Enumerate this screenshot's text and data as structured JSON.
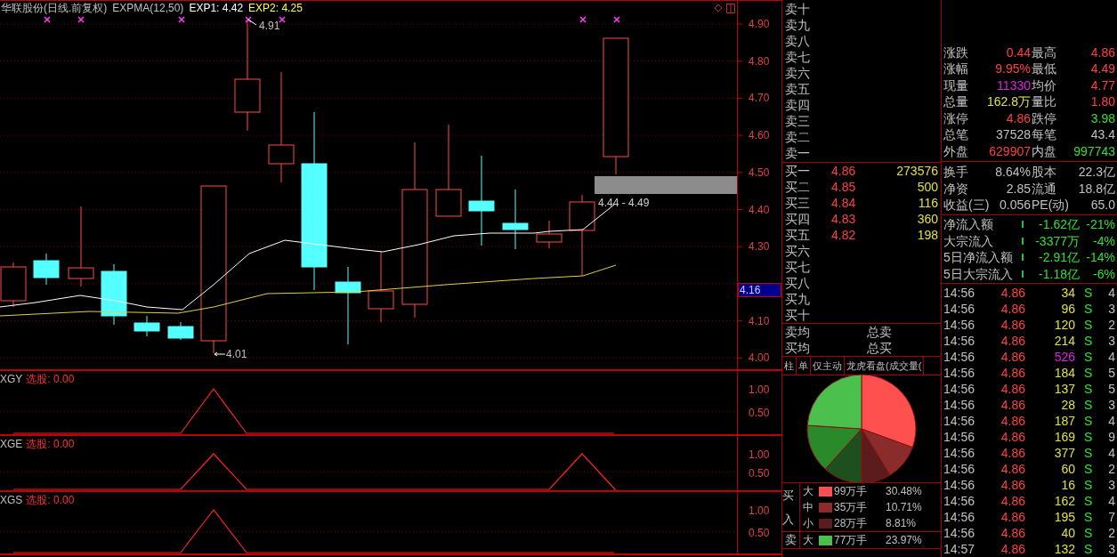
{
  "chart_header": {
    "title": "华联股份(日线.前复权)",
    "indicator": "EXPMA(12,50)",
    "exp1": "EXP1: 4.42",
    "exp2": "EXP2: 4.25"
  },
  "price_axis": {
    "ticks": [
      "4.90",
      "4.80",
      "4.70",
      "4.60",
      "4.50",
      "4.40",
      "4.30",
      "4.10",
      "4.00"
    ],
    "current_price": "4.16"
  },
  "chart_labels": {
    "high": "4.91",
    "low": "4.01",
    "range": "4.44 - 4.49"
  },
  "indicators": [
    {
      "name": "XGY",
      "label": "选股: 0.00",
      "ticks": [
        "1.00",
        "0.50"
      ]
    },
    {
      "name": "XGE",
      "label": "选股: 0.00",
      "ticks": [
        "1.00",
        "0.50"
      ]
    },
    {
      "name": "XGS",
      "label": "选股: 0.00",
      "ticks": [
        "1.00",
        "0.50"
      ]
    }
  ],
  "order_book": {
    "sell": [
      {
        "label": "卖十"
      },
      {
        "label": "卖九"
      },
      {
        "label": "卖八"
      },
      {
        "label": "卖七"
      },
      {
        "label": "卖六"
      },
      {
        "label": "卖五"
      },
      {
        "label": "卖四"
      },
      {
        "label": "卖三"
      },
      {
        "label": "卖二"
      },
      {
        "label": "卖一"
      }
    ],
    "buy": [
      {
        "label": "买一",
        "price": "4.86",
        "volume": "273576"
      },
      {
        "label": "买二",
        "price": "4.85",
        "volume": "500"
      },
      {
        "label": "买三",
        "price": "4.84",
        "volume": "116"
      },
      {
        "label": "买四",
        "price": "4.83",
        "volume": "360"
      },
      {
        "label": "买五",
        "price": "4.82",
        "volume": "198"
      },
      {
        "label": "买六"
      },
      {
        "label": "买七"
      },
      {
        "label": "买八"
      },
      {
        "label": "买九"
      },
      {
        "label": "买十"
      }
    ],
    "averages": [
      {
        "label": "卖均",
        "total": "总卖"
      },
      {
        "label": "买均",
        "total": "总买"
      }
    ]
  },
  "tabs": [
    {
      "label": "柱"
    },
    {
      "label": "单"
    },
    {
      "label": "仅主动"
    },
    {
      "label": "龙虎看盘(成交量("
    }
  ],
  "flow_legend": [
    {
      "side": "买入",
      "rows": [
        {
          "size": "大",
          "amount": "99万手",
          "percent": "30.48%",
          "color": "#ff5050"
        },
        {
          "size": "中",
          "amount": "35万手",
          "percent": "10.71%",
          "color": "#8b2c2c"
        },
        {
          "size": "小",
          "amount": "28万手",
          "percent": "8.81%",
          "color": "#5a1c1c"
        }
      ]
    },
    {
      "side": "卖",
      "rows": [
        {
          "size": "大",
          "amount": "77万手",
          "percent": "23.97%",
          "color": "#4cc04c"
        }
      ]
    }
  ],
  "quote": [
    {
      "cells": [
        {
          "label": "涨跌",
          "value": "0.44",
          "color": "#ff4040"
        },
        {
          "label": "最高",
          "value": "4.86",
          "color": "#ff4040"
        }
      ]
    },
    {
      "cells": [
        {
          "label": "涨幅",
          "value": "9.95%",
          "color": "#ff4040"
        },
        {
          "label": "最低",
          "value": "4.49",
          "color": "#ff4040"
        }
      ]
    },
    {
      "cells": [
        {
          "label": "现量",
          "value": "11330",
          "color": "#e020e0"
        },
        {
          "label": "均价",
          "value": "4.77",
          "color": "#ff4040"
        }
      ]
    },
    {
      "cells": [
        {
          "label": "总量",
          "value": "162.8万",
          "color": "#e0e040"
        },
        {
          "label": "量比",
          "value": "1.80",
          "color": "#ff4040"
        }
      ]
    },
    {
      "cells": [
        {
          "label": "涨停",
          "value": "4.86",
          "color": "#ff4040"
        },
        {
          "label": "跌停",
          "value": "3.98",
          "color": "#30e030"
        }
      ]
    },
    {
      "cells": [
        {
          "label": "总笔",
          "value": "37528",
          "color": "#c0c0c0"
        },
        {
          "label": "每笔",
          "value": "43.4",
          "color": "#c0c0c0"
        }
      ]
    },
    {
      "cells": [
        {
          "label": "外盘",
          "value": "629907",
          "color": "#ff4040"
        },
        {
          "label": "内盘",
          "value": "997743",
          "color": "#30e030"
        }
      ]
    }
  ],
  "fundamentals": [
    {
      "label": "换手",
      "value": "8.64%",
      "label2": "股本",
      "value2": "22.3亿"
    },
    {
      "label": "净资",
      "value": "2.85",
      "label2": "流通",
      "value2": "18.8亿"
    },
    {
      "label": "收益(三)",
      "value": "0.056",
      "label2": "PE(动)",
      "value2": "65.0"
    }
  ],
  "fund_flow": [
    {
      "label": "净流入额",
      "amount": "-1.62亿",
      "percent": "-21%"
    },
    {
      "label": "大宗流入",
      "amount": "-3377万",
      "percent": "-4%"
    },
    {
      "label": "5日净流入额",
      "amount": "-2.91亿",
      "percent": "-14%"
    },
    {
      "label": "5日大宗流入",
      "amount": "-1.18亿",
      "percent": "-6%"
    }
  ],
  "trades": [
    {
      "time": "14:56",
      "price": "4.86",
      "volume": "34",
      "side": "S",
      "count": "4",
      "highlight": false
    },
    {
      "time": "14:56",
      "price": "4.86",
      "volume": "96",
      "side": "S",
      "count": "3",
      "highlight": false
    },
    {
      "time": "14:56",
      "price": "4.86",
      "volume": "120",
      "side": "S",
      "count": "2",
      "highlight": false
    },
    {
      "time": "14:56",
      "price": "4.86",
      "volume": "214",
      "side": "S",
      "count": "3",
      "highlight": false
    },
    {
      "time": "14:56",
      "price": "4.86",
      "volume": "526",
      "side": "S",
      "count": "4",
      "highlight": true
    },
    {
      "time": "14:56",
      "price": "4.86",
      "volume": "184",
      "side": "S",
      "count": "5",
      "highlight": false
    },
    {
      "time": "14:56",
      "price": "4.86",
      "volume": "137",
      "side": "S",
      "count": "5",
      "highlight": false
    },
    {
      "time": "14:56",
      "price": "4.86",
      "volume": "28",
      "side": "S",
      "count": "3",
      "highlight": false
    },
    {
      "time": "14:56",
      "price": "4.86",
      "volume": "187",
      "side": "S",
      "count": "4",
      "highlight": false
    },
    {
      "time": "14:56",
      "price": "4.86",
      "volume": "169",
      "side": "S",
      "count": "9",
      "highlight": false
    },
    {
      "time": "14:56",
      "price": "4.86",
      "volume": "377",
      "side": "S",
      "count": "4",
      "highlight": false
    },
    {
      "time": "14:56",
      "price": "4.86",
      "volume": "60",
      "side": "S",
      "count": "2",
      "highlight": false
    },
    {
      "time": "14:56",
      "price": "4.86",
      "volume": "16",
      "side": "S",
      "count": "3",
      "highlight": false
    },
    {
      "time": "14:56",
      "price": "4.86",
      "volume": "162",
      "side": "S",
      "count": "4",
      "highlight": false
    },
    {
      "time": "14:56",
      "price": "4.86",
      "volume": "195",
      "side": "S",
      "count": "7",
      "highlight": false
    },
    {
      "time": "14:56",
      "price": "4.86",
      "volume": "40",
      "side": "S",
      "count": "2",
      "highlight": false
    },
    {
      "time": "14:57",
      "price": "4.86",
      "volume": "132",
      "side": "S",
      "count": "3",
      "highlight": false
    }
  ]
}
